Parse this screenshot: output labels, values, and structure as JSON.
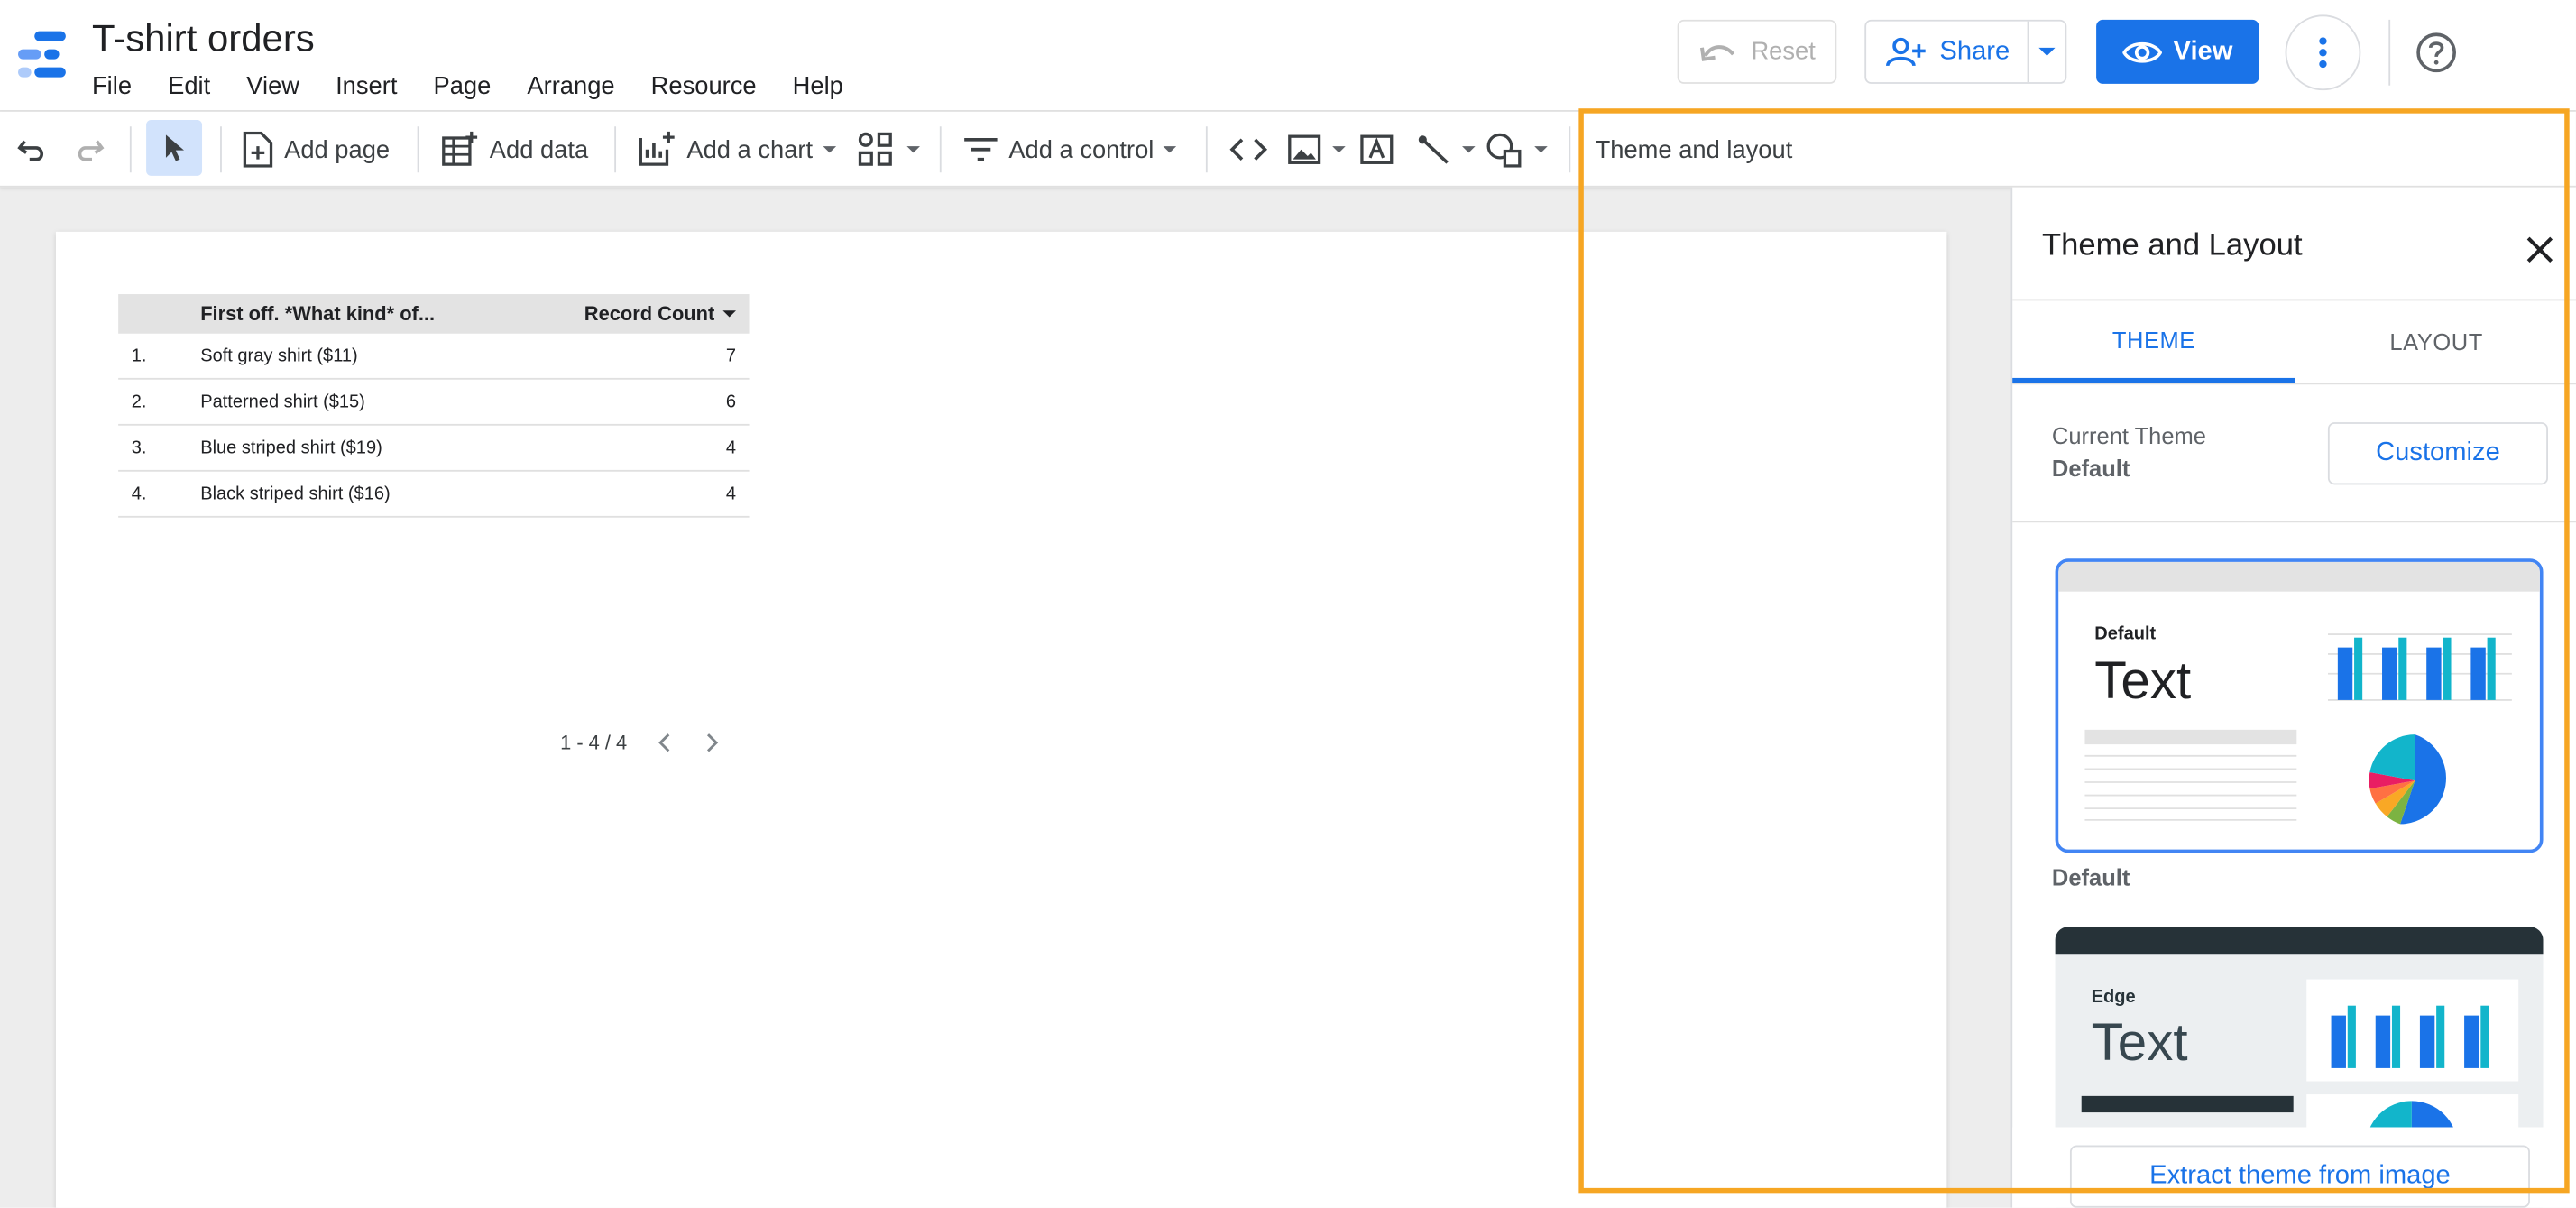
{
  "app": {
    "title": "T-shirt orders",
    "menu": [
      "File",
      "Edit",
      "View",
      "Insert",
      "Page",
      "Arrange",
      "Resource",
      "Help"
    ],
    "reset_label": "Reset",
    "share_label": "Share",
    "view_label": "View",
    "brand_color": "#1a73e8"
  },
  "toolbar": {
    "add_page": "Add page",
    "add_data": "Add data",
    "add_chart": "Add a chart",
    "add_control": "Add a control",
    "theme_layout": "Theme and layout",
    "icons": [
      "undo-icon",
      "redo-icon",
      "select-icon",
      "add-page-icon",
      "add-data-icon",
      "add-chart-icon",
      "community-viz-icon",
      "filter-icon",
      "code-icon",
      "image-icon",
      "text-icon",
      "line-icon",
      "shape-icon"
    ]
  },
  "table": {
    "columns": [
      "First off. *What kind* of...",
      "Record Count"
    ],
    "rows": [
      {
        "num": "1.",
        "label": "Soft gray shirt ($11)",
        "count": "7"
      },
      {
        "num": "2.",
        "label": "Patterned shirt ($15)",
        "count": "6"
      },
      {
        "num": "3.",
        "label": "Blue striped shirt ($19)",
        "count": "4"
      },
      {
        "num": "4.",
        "label": "Black striped shirt ($16)",
        "count": "4"
      }
    ],
    "pagination": "1 - 4 / 4"
  },
  "panel": {
    "title": "Theme and Layout",
    "tabs": [
      "THEME",
      "LAYOUT"
    ],
    "active_tab": "THEME",
    "current_theme_label": "Current Theme",
    "current_theme_value": "Default",
    "customize_label": "Customize",
    "themes": [
      {
        "card_label": "Default",
        "card_text": "Text",
        "name": "Default"
      },
      {
        "card_label": "Edge",
        "card_text": "Text",
        "name": ""
      }
    ],
    "extract_label": "Extract theme from image"
  },
  "highlight_color": "#f6a623"
}
